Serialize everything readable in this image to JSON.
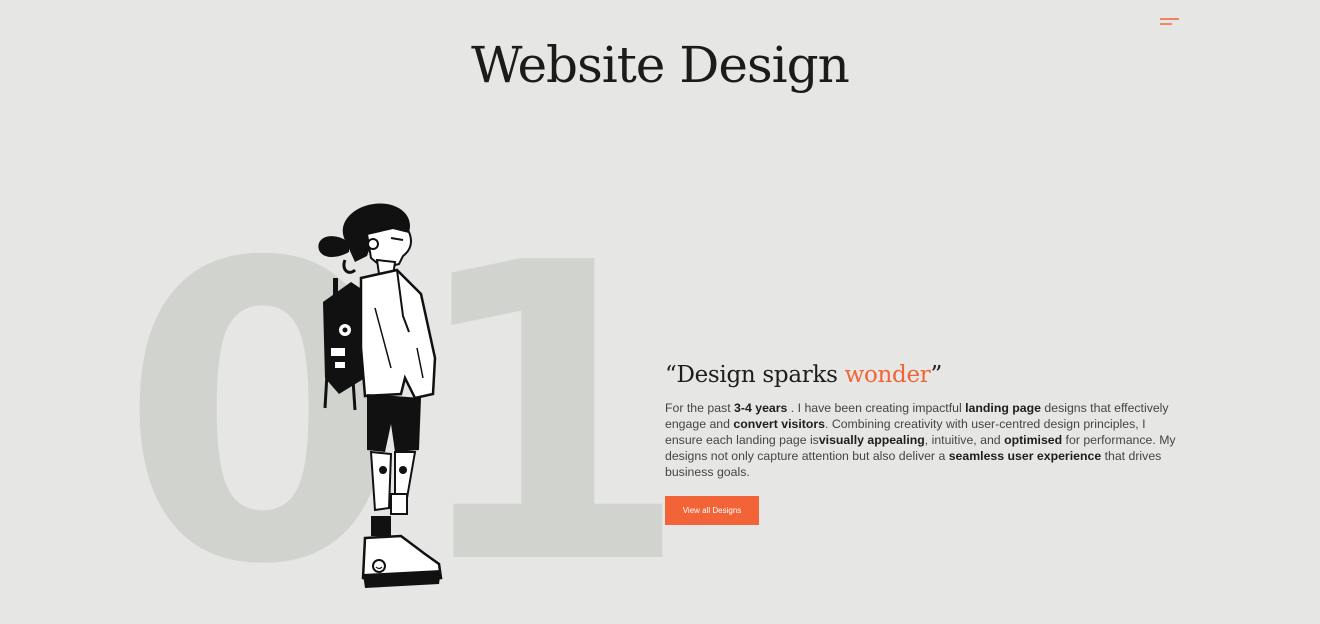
{
  "header": {
    "title": "Website Design",
    "menu_icon": "hamburger-menu-icon"
  },
  "section": {
    "number": "01",
    "illustration": "standing-girl-with-backpack-illustration",
    "quote_open": "“Design sparks ",
    "quote_accent": "wonder",
    "quote_close": "”",
    "description": [
      {
        "t": "For the past ",
        "b": false
      },
      {
        "t": "3-4 years",
        "b": true
      },
      {
        "t": " . I have been creating impactful ",
        "b": false
      },
      {
        "t": "landing page",
        "b": true
      },
      {
        "t": " designs that effectively engage and ",
        "b": false
      },
      {
        "t": "convert visitors",
        "b": true
      },
      {
        "t": ". Combining creativity with user-centred design principles, I ensure each landing page is",
        "b": false
      },
      {
        "t": "visually appealing",
        "b": true
      },
      {
        "t": ", intuitive, and ",
        "b": false
      },
      {
        "t": "optimised",
        "b": true
      },
      {
        "t": " for performance. My designs not only capture attention but also deliver a ",
        "b": false
      },
      {
        "t": "seamless user experience",
        "b": true
      },
      {
        "t": " that drives business goals.",
        "b": false
      }
    ],
    "cta_label": "View all Designs"
  },
  "colors": {
    "background": "#e6e7e4",
    "accent": "#f26437",
    "number_watermark": "#d1d3cf"
  }
}
